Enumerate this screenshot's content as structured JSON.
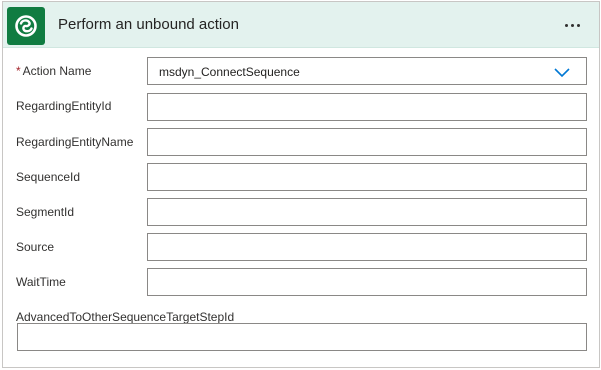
{
  "action": {
    "title": "Perform an unbound action",
    "more_options_icon": "ellipsis-icon",
    "connector_icon": "dataverse-logo-icon"
  },
  "fields": {
    "action_name": {
      "label": "Action Name",
      "required_mark": "*",
      "value": "msdyn_ConnectSequence"
    },
    "regarding_entity_id": {
      "label": "RegardingEntityId",
      "value": ""
    },
    "regarding_entity_name": {
      "label": "RegardingEntityName",
      "value": ""
    },
    "sequence_id": {
      "label": "SequenceId",
      "value": ""
    },
    "segment_id": {
      "label": "SegmentId",
      "value": ""
    },
    "source": {
      "label": "Source",
      "value": ""
    },
    "wait_time": {
      "label": "WaitTime",
      "value": ""
    },
    "advanced_target_step_id": {
      "label": "AdvancedToOtherSequenceTargetStepId",
      "value": ""
    }
  },
  "colors": {
    "header_bg": "#e3f2ee",
    "brand": "#107c41",
    "required": "#a4262c",
    "accent": "#0078d4"
  }
}
